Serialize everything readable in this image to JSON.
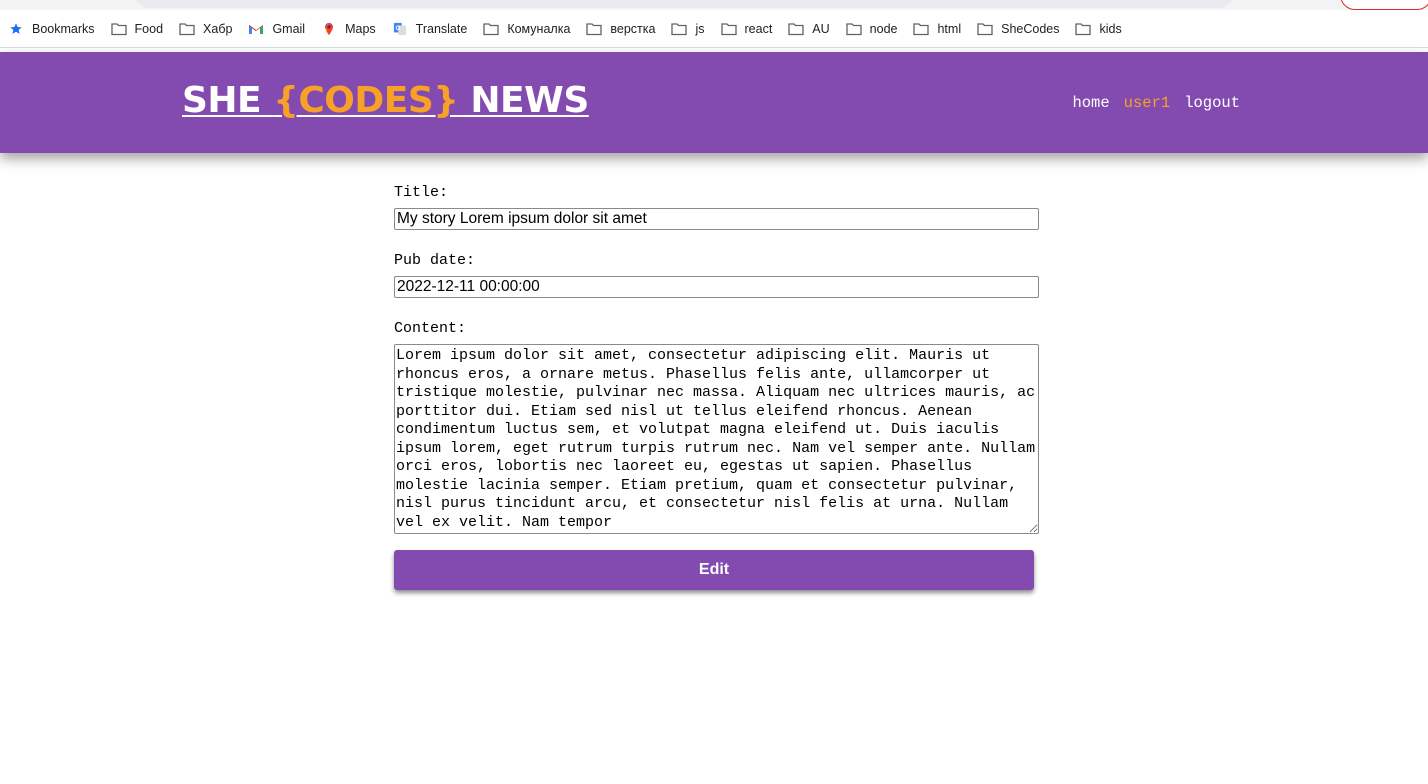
{
  "bookmarks": [
    {
      "label": "Bookmarks",
      "icon": "star-icon"
    },
    {
      "label": "Food",
      "icon": "folder-icon"
    },
    {
      "label": "Хабр",
      "icon": "folder-icon"
    },
    {
      "label": "Gmail",
      "icon": "gmail-icon"
    },
    {
      "label": "Maps",
      "icon": "maps-icon"
    },
    {
      "label": "Translate",
      "icon": "translate-icon"
    },
    {
      "label": "Комуналка",
      "icon": "folder-icon"
    },
    {
      "label": "верстка",
      "icon": "folder-icon"
    },
    {
      "label": "js",
      "icon": "folder-icon"
    },
    {
      "label": "react",
      "icon": "folder-icon"
    },
    {
      "label": "AU",
      "icon": "folder-icon"
    },
    {
      "label": "node",
      "icon": "folder-icon"
    },
    {
      "label": "html",
      "icon": "folder-icon"
    },
    {
      "label": "SheCodes",
      "icon": "folder-icon"
    },
    {
      "label": "kids",
      "icon": "folder-icon"
    }
  ],
  "header": {
    "logo_part1": "SHE ",
    "logo_part2": "{CODES}",
    "logo_part3": " NEWS",
    "nav_home": "home",
    "nav_user": "user1",
    "nav_logout": "logout"
  },
  "form": {
    "title_label": "Title:",
    "title_value": "My story Lorem ipsum dolor sit amet",
    "pubdate_label": "Pub date:",
    "pubdate_value": "2022-12-11 00:00:00",
    "content_label": "Content:",
    "content_value": "Lorem ipsum dolor sit amet, consectetur adipiscing elit. Mauris ut rhoncus eros, a ornare metus. Phasellus felis ante, ullamcorper ut tristique molestie, pulvinar nec massa. Aliquam nec ultrices mauris, ac porttitor dui. Etiam sed nisl ut tellus eleifend rhoncus. Aenean condimentum luctus sem, et volutpat magna eleifend ut. Duis iaculis ipsum lorem, eget rutrum turpis rutrum nec. Nam vel semper ante. Nullam orci eros, lobortis nec laoreet eu, egestas ut sapien. Phasellus molestie lacinia semper. Etiam pretium, quam et consectetur pulvinar, nisl purus tincidunt arcu, et consectetur nisl felis at urna. Nullam vel ex velit. Nam tempor",
    "submit_label": "Edit"
  },
  "colors": {
    "brand": "#834baf",
    "accent": "#f7a128"
  }
}
